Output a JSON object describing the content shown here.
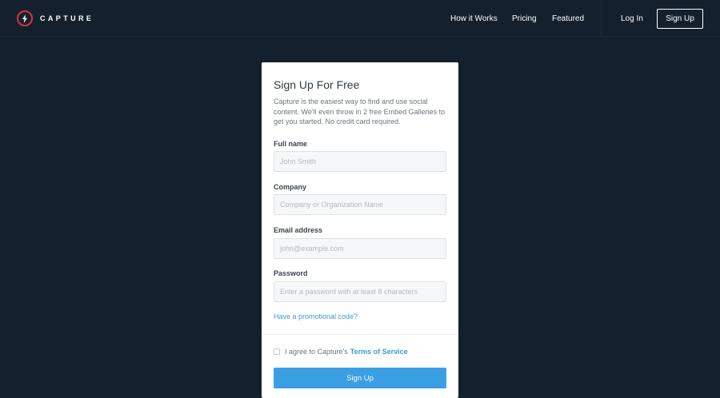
{
  "brand": {
    "name": "CAPTURE",
    "accent_color": "#e0313d",
    "logo_icon": "lightning-icon"
  },
  "nav": {
    "links": [
      {
        "label": "How it Works"
      },
      {
        "label": "Pricing"
      },
      {
        "label": "Featured"
      }
    ],
    "login_label": "Log In",
    "signup_label": "Sign Up"
  },
  "form": {
    "title": "Sign Up For Free",
    "description": "Capture is the easiest way to find and use social content. We'll even throw in 2 free Embed Galleries to get you started. No credit card required.",
    "fields": [
      {
        "label": "Full name",
        "placeholder": "John Smith",
        "value": ""
      },
      {
        "label": "Company",
        "placeholder": "Company or Organization Name",
        "value": ""
      },
      {
        "label": "Email address",
        "placeholder": "john@example.com",
        "value": ""
      },
      {
        "label": "Password",
        "placeholder": "Enter a password with at least 8 characters",
        "value": ""
      }
    ],
    "promo_link": "Have a promotional code?",
    "agree_text": "I agree to Capture's",
    "tos_link": "Terms of Service",
    "submit_label": "Sign Up",
    "link_color": "#3a9ad9",
    "button_color": "#3a9fe3"
  }
}
